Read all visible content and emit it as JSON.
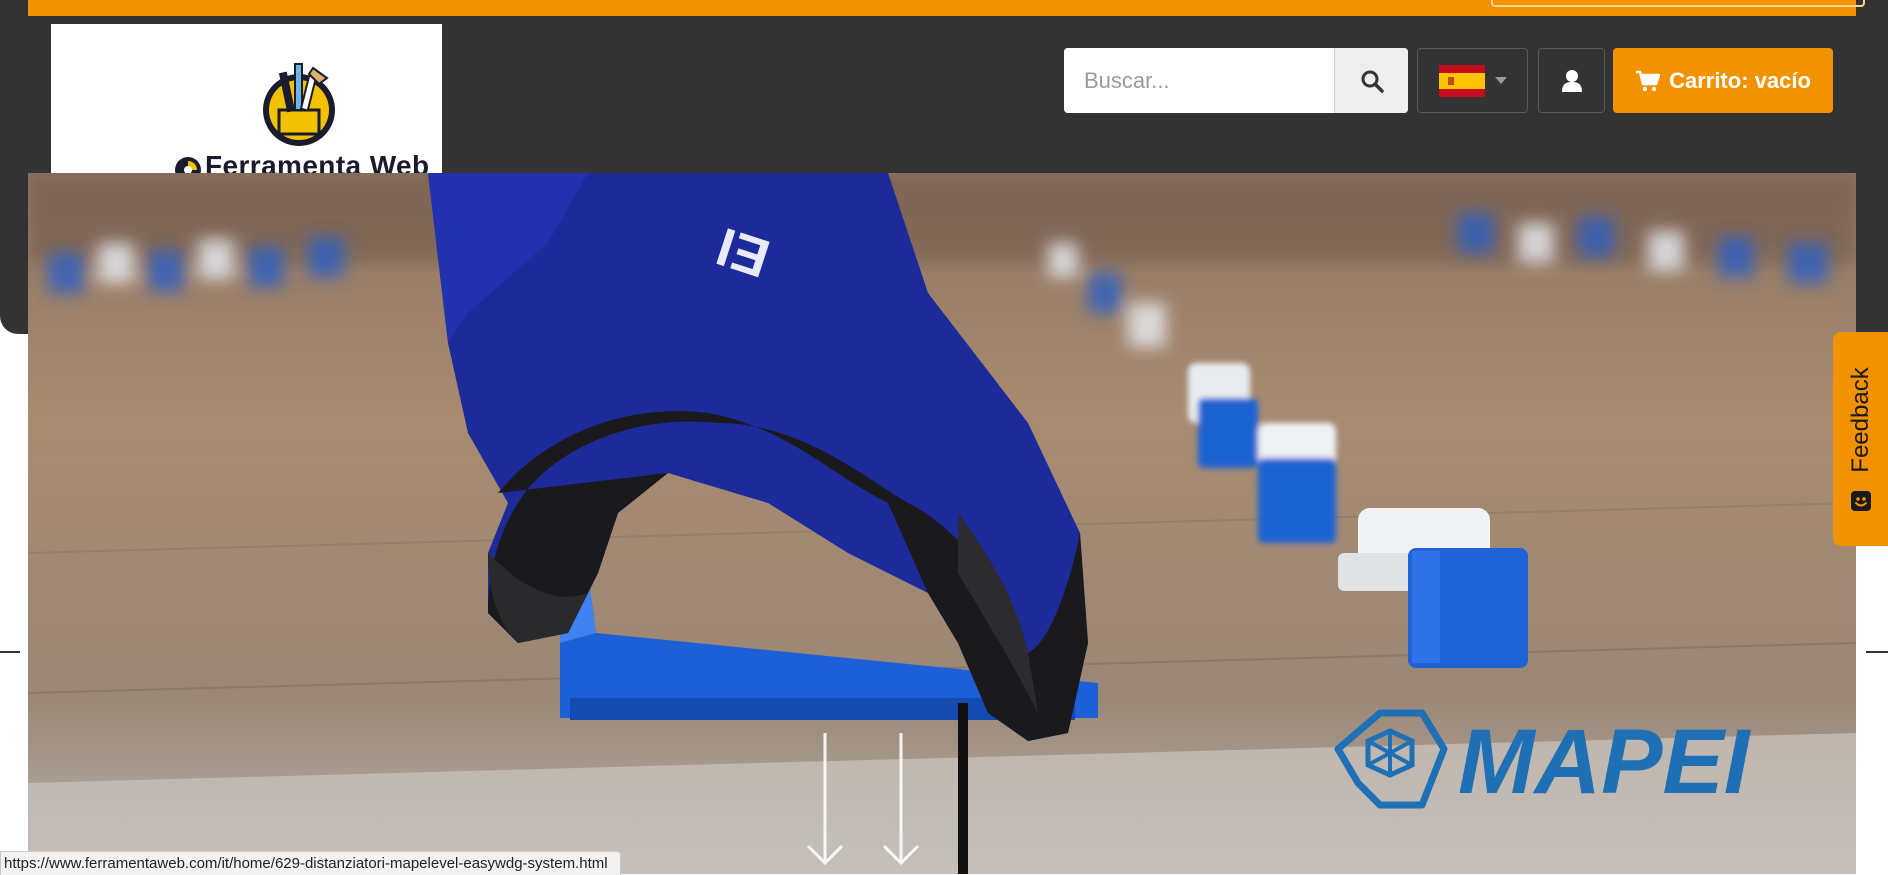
{
  "header": {
    "logo": {
      "text": "Ferramenta Web"
    },
    "search": {
      "placeholder": "Buscar...",
      "value": ""
    },
    "language": {
      "selected": "Español",
      "flag_colors": [
        "#c60b1e",
        "#ffc400"
      ]
    },
    "cart": {
      "label": "Carrito: vacío"
    }
  },
  "hero": {
    "brand_text": "MAPEI",
    "brand_color": "#1f6fb4"
  },
  "feedback": {
    "label": "Feedback"
  },
  "status_bar": {
    "url": "https://www.ferramentaweb.com/it/home/629-distanziatori-mapelevel-easywdg-system.html"
  },
  "colors": {
    "accent": "#f39200",
    "header_bg": "#333333"
  }
}
